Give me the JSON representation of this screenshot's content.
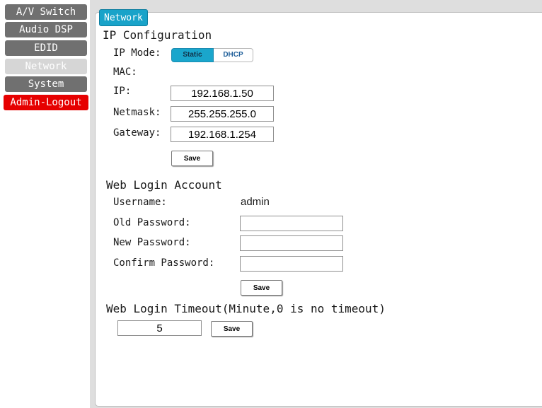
{
  "nav": {
    "items": [
      {
        "label": "A/V Switch"
      },
      {
        "label": "Audio DSP"
      },
      {
        "label": "EDID"
      },
      {
        "label": "Network"
      },
      {
        "label": "System"
      },
      {
        "label": "Admin-Logout"
      }
    ],
    "active": "Network"
  },
  "tab": {
    "label": "Network"
  },
  "ip_config": {
    "heading": "IP Configuration",
    "ip_mode_label": "IP Mode:",
    "ip_mode_options": [
      "Static",
      "DHCP"
    ],
    "ip_mode_selected": "Static",
    "mac_label": "MAC:",
    "ip_label": "IP:",
    "ip_value": "192.168.1.50",
    "netmask_label": "Netmask:",
    "netmask_value": "255.255.255.0",
    "gateway_label": "Gateway:",
    "gateway_value": "192.168.1.254",
    "save_label": "Save"
  },
  "web_login": {
    "heading": "Web Login Account",
    "username_label": "Username:",
    "username_value": "admin",
    "old_password_label": "Old Password:",
    "new_password_label": "New Password:",
    "confirm_password_label": "Confirm Password:",
    "save_label": "Save"
  },
  "timeout": {
    "heading": "Web Login Timeout(Minute,0 is no timeout)",
    "value": "5",
    "save_label": "Save"
  },
  "colors": {
    "nav_inactive": "#707070",
    "nav_active": "#d6d6d6",
    "logout": "#e60000",
    "tab_accent": "#19a3c9"
  }
}
